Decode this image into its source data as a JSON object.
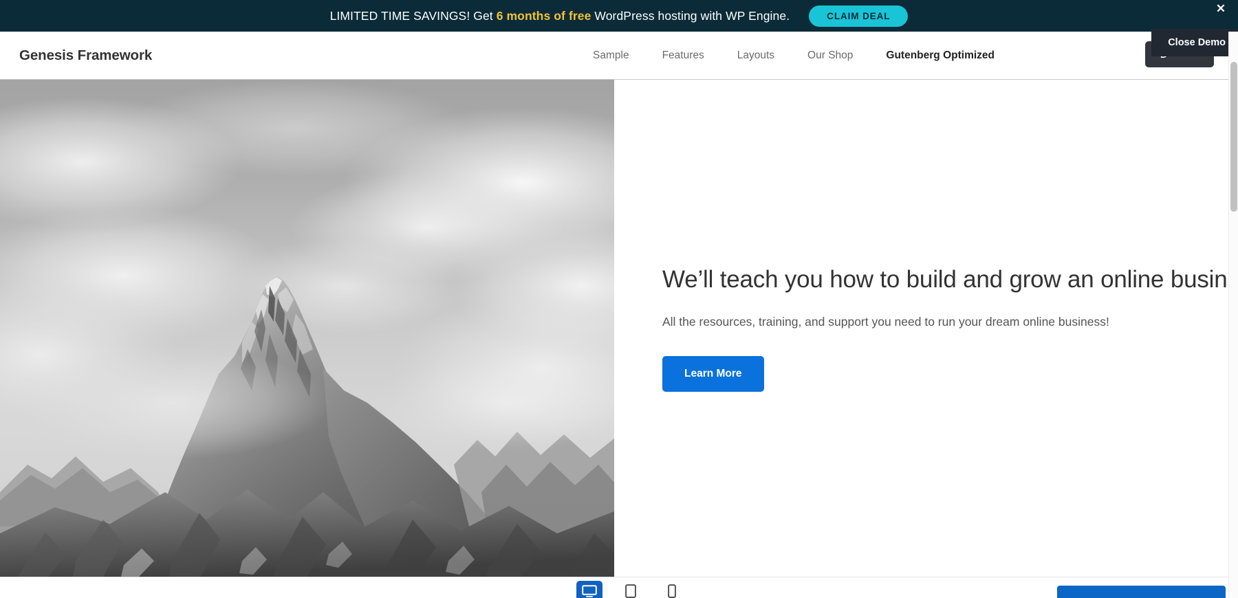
{
  "promo": {
    "text_before": "LIMITED TIME SAVINGS! Get ",
    "highlight": "6 months of free",
    "text_after": " WordPress hosting with WP Engine.",
    "cta_label": "CLAIM DEAL",
    "close_icon": "close-x-icon",
    "bg_color": "#0b2b38",
    "highlight_color": "#f2c335",
    "cta_color": "#19c4d6"
  },
  "header": {
    "site_title": "Genesis Framework",
    "nav": [
      {
        "label": "Sample",
        "active": false
      },
      {
        "label": "Features",
        "active": false
      },
      {
        "label": "Layouts",
        "active": false
      },
      {
        "label": "Our Shop",
        "active": false
      },
      {
        "label": "Gutenberg Optimized",
        "active": true
      }
    ]
  },
  "demo_controls": {
    "download_label": "D",
    "close_demo_label": "Close Demo"
  },
  "hero": {
    "image_alt": "grayscale-mountain-peak-photo",
    "heading": "We’ll teach you how to build and grow an online business.",
    "subheading": "All the resources, training, and support you need to run your dream online business!",
    "button_label": "Learn More",
    "button_color": "#0b72dd"
  },
  "preview_toolbar": {
    "devices": [
      {
        "name": "desktop-view-icon",
        "active": true
      },
      {
        "name": "tablet-view-icon",
        "active": false
      },
      {
        "name": "mobile-view-icon",
        "active": false
      }
    ],
    "footer_cta_color": "#0c66c5"
  },
  "scrollbar": {
    "thumb_color": "#c0c0c0"
  }
}
